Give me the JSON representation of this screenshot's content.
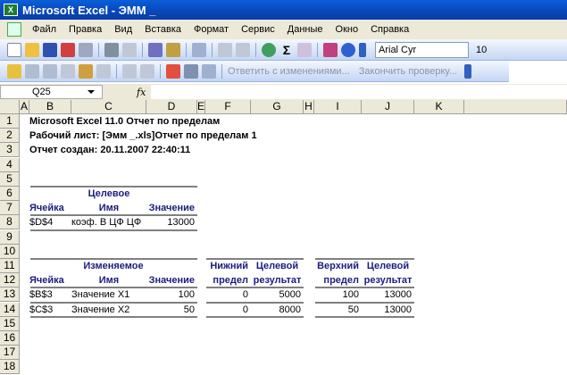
{
  "window": {
    "title": "Microsoft Excel - ЭММ _"
  },
  "menu": [
    "Файл",
    "Правка",
    "Вид",
    "Вставка",
    "Формат",
    "Сервис",
    "Данные",
    "Окно",
    "Справка"
  ],
  "toolbar": {
    "font": "Arial Cyr",
    "size": "10"
  },
  "review_toolbar": {
    "reply": "Ответить с изменениями...",
    "end_review": "Закончить проверку..."
  },
  "formula_bar": {
    "name_box": "Q25",
    "fx": "fx",
    "value": ""
  },
  "columns": [
    "A",
    "B",
    "C",
    "D",
    "E",
    "F",
    "G",
    "H",
    "I",
    "J",
    "K"
  ],
  "rows": [
    "1",
    "2",
    "3",
    "4",
    "5",
    "6",
    "7",
    "8",
    "9",
    "10",
    "11",
    "12",
    "13",
    "14",
    "15",
    "16",
    "17",
    "18"
  ],
  "report": {
    "line1": "Microsoft Excel 11.0 Отчет по пределам",
    "line2": "Рабочий лист: [Эмм _.xls]Отчет по пределам 1",
    "line3": "Отчет создан: 20.11.2007 22:40:11"
  },
  "target": {
    "group": "Целевое",
    "headers": [
      "Ячейка",
      "Имя",
      "Значение"
    ],
    "row": [
      "$D$4",
      "коэф. В ЦФ ЦФ",
      "13000"
    ]
  },
  "variables": {
    "group": "Изменяемое",
    "headers": [
      "Ячейка",
      "Имя",
      "Значение"
    ],
    "rows": [
      [
        "$B$3",
        "Значение  X1",
        "100"
      ],
      [
        "$C$3",
        "Значение  X2",
        "50"
      ]
    ]
  },
  "lower": {
    "headers1": [
      "Нижний",
      "Целевой"
    ],
    "headers2": [
      "предел",
      "результат"
    ],
    "rows": [
      [
        "0",
        "5000"
      ],
      [
        "0",
        "8000"
      ]
    ]
  },
  "upper": {
    "headers1": [
      "Верхний",
      "Целевой"
    ],
    "headers2": [
      "предел",
      "результат"
    ],
    "rows": [
      [
        "100",
        "13000"
      ],
      [
        "50",
        "13000"
      ]
    ]
  }
}
